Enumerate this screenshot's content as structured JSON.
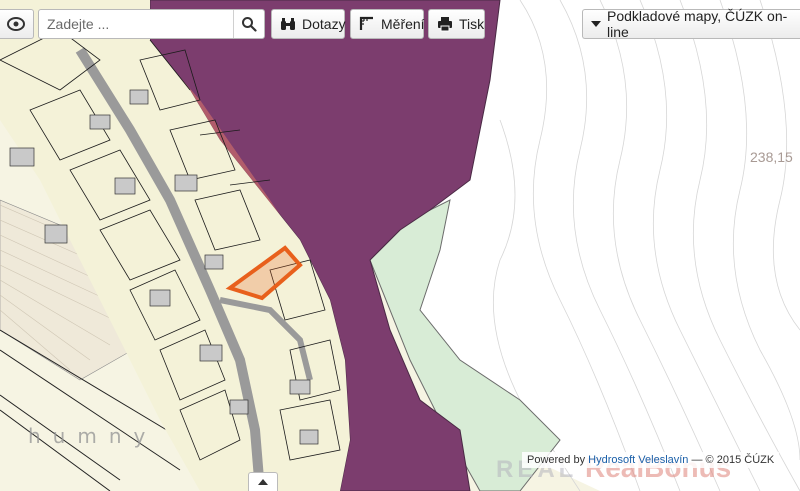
{
  "toolbar": {
    "search_placeholder": "Zadejte ...",
    "queries_label": "Dotazy",
    "measure_label": "Měření",
    "print_label": "Tisk",
    "basemaps_label": "Podkladové mapy, ČÚZK on-line"
  },
  "icons": {
    "logo": "layers-logo-icon",
    "search": "search-icon",
    "queries": "binoculars-icon",
    "measure": "measure-corner-icon",
    "print": "printer-icon",
    "basemaps": "caret-down-icon",
    "scroll": "chevron-up-icon"
  },
  "map": {
    "elevation_label": "238,15",
    "place_label": "humny",
    "watermark_a": "REAL",
    "watermark_b": "RealBonus",
    "colors": {
      "flood_zone": "#7c3d6e",
      "paper": "#f3f1dc",
      "green_area": "#d8ecd6",
      "parcel_highlight": "#e8601c",
      "buildings": "#c9c9c9",
      "parcel_lines": "#1c1c1c"
    }
  },
  "attribution": {
    "powered_by": "Powered by",
    "company": "Hydrosoft Veleslavín",
    "copyright": "— © 2015 ČÚZK"
  }
}
